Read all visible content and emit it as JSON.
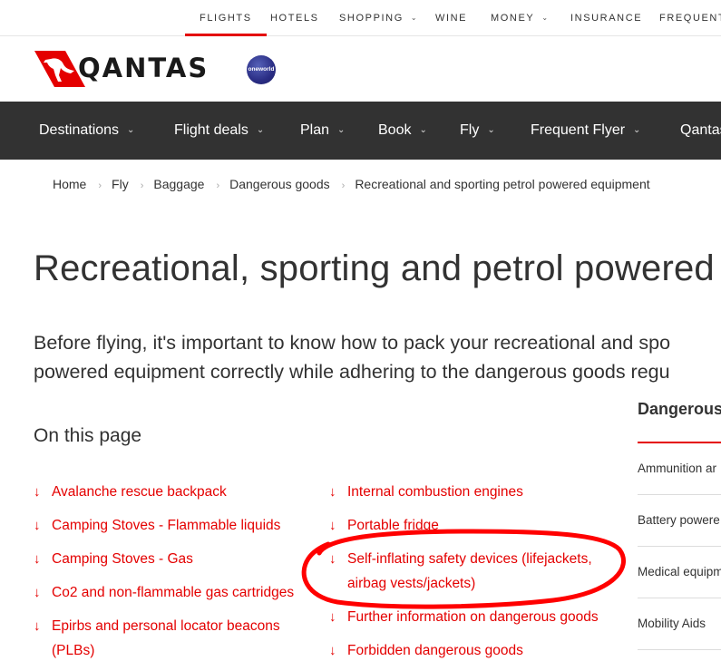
{
  "topbar": {
    "items": [
      {
        "label": "FLIGHTS",
        "dropdown": false,
        "active": true
      },
      {
        "label": "HOTELS",
        "dropdown": false,
        "active": false
      },
      {
        "label": "SHOPPING",
        "dropdown": true,
        "active": false
      },
      {
        "label": "WINE",
        "dropdown": false,
        "active": false
      },
      {
        "label": "MONEY",
        "dropdown": true,
        "active": false
      },
      {
        "label": "INSURANCE",
        "dropdown": false,
        "active": false
      },
      {
        "label": "FREQUENT F",
        "dropdown": false,
        "active": false
      }
    ]
  },
  "brand": {
    "name": "QANTAS",
    "partner_badge": "oneworld",
    "accent_color": "#e40000",
    "nav_bg": "#323232"
  },
  "mainnav": {
    "items": [
      {
        "label": "Destinations"
      },
      {
        "label": "Flight deals"
      },
      {
        "label": "Plan"
      },
      {
        "label": "Book"
      },
      {
        "label": "Fly"
      },
      {
        "label": "Frequent Flyer"
      },
      {
        "label": "Qantas"
      }
    ]
  },
  "breadcrumb": [
    "Home",
    "Fly",
    "Baggage",
    "Dangerous goods",
    "Recreational and sporting petrol powered equipment"
  ],
  "page": {
    "title": "Recreational, sporting and petrol powered",
    "intro_line1": "Before flying, it's important to know how to pack your recreational and spo",
    "intro_line2": "powered equipment correctly while adhering to the dangerous goods regu",
    "on_this_page": "On this page"
  },
  "links_left": [
    {
      "lines": [
        "Avalanche rescue backpack"
      ]
    },
    {
      "lines": [
        "Camping Stoves - Flammable liquids"
      ]
    },
    {
      "lines": [
        "Camping Stoves - Gas"
      ]
    },
    {
      "lines": [
        "Co2 and non-flammable gas cartridges"
      ]
    },
    {
      "lines": [
        "Epirbs and personal locator beacons",
        "(PLBs)"
      ]
    }
  ],
  "links_right": [
    {
      "lines": [
        "Internal combustion engines"
      ]
    },
    {
      "lines": [
        "Portable fridge"
      ]
    },
    {
      "lines": [
        "Self-inflating safety devices (lifejackets,",
        "airbag vests/jackets)"
      ]
    },
    {
      "lines": [
        "Further information on dangerous goods"
      ]
    },
    {
      "lines": [
        "Forbidden dangerous goods"
      ]
    }
  ],
  "sidebar": {
    "heading": "Dangerous",
    "items": [
      "Ammunition ar",
      "Battery powere",
      "Medical equipm",
      "Mobility Aids"
    ]
  }
}
